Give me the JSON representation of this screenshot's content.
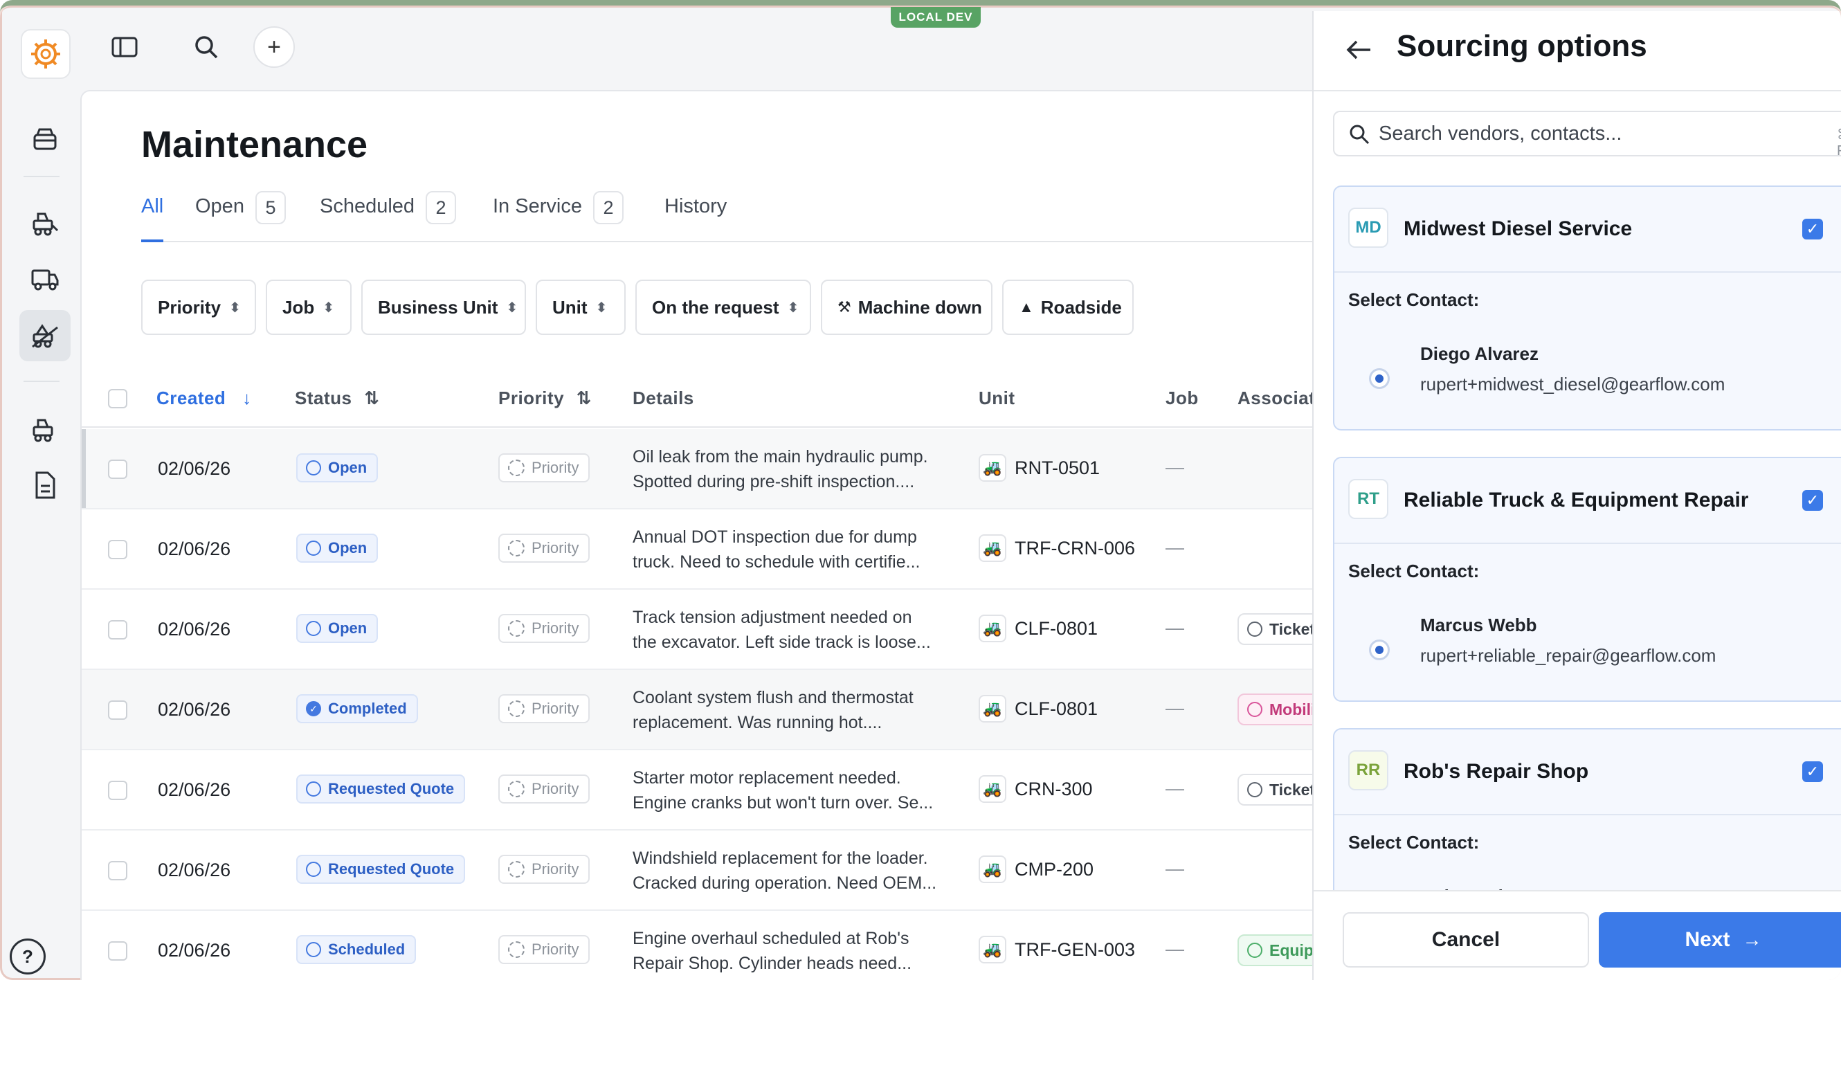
{
  "environment_badge": "LOCAL DEV",
  "page": {
    "title": "Maintenance",
    "tabs": [
      {
        "label": "All",
        "count": ""
      },
      {
        "label": "Open",
        "count": "5"
      },
      {
        "label": "Scheduled",
        "count": "2"
      },
      {
        "label": "In Service",
        "count": "2"
      },
      {
        "label": "History",
        "count": ""
      }
    ],
    "filters": [
      "Priority",
      "Job",
      "Business Unit",
      "Unit",
      "On the request",
      "Machine down",
      "Roadside"
    ],
    "columns": [
      "Created",
      "Status",
      "Priority",
      "Details",
      "Unit",
      "Job",
      "Associat"
    ],
    "rows": [
      {
        "date": "02/06/26",
        "status": "Open",
        "priority": "Priority",
        "details1": "Oil leak from the main hydraulic pump.",
        "details2": "Spotted during pre-shift inspection....",
        "unit": "RNT-0501",
        "job": "—",
        "assoc": ""
      },
      {
        "date": "02/06/26",
        "status": "Open",
        "priority": "Priority",
        "details1": "Annual DOT inspection due for dump",
        "details2": "truck. Need to schedule with certifie...",
        "unit": "TRF-CRN-006",
        "job": "—",
        "assoc": ""
      },
      {
        "date": "02/06/26",
        "status": "Open",
        "priority": "Priority",
        "details1": "Track tension adjustment needed on",
        "details2": "the excavator. Left side track is loose...",
        "unit": "CLF-0801",
        "job": "—",
        "assoc": "Ticket"
      },
      {
        "date": "02/06/26",
        "status": "Completed",
        "priority": "Priority",
        "details1": "Coolant system flush and thermostat",
        "details2": "replacement. Was running hot....",
        "unit": "CLF-0801",
        "job": "—",
        "assoc": "Mobili"
      },
      {
        "date": "02/06/26",
        "status": "Requested Quote",
        "priority": "Priority",
        "details1": "Starter motor replacement needed.",
        "details2": "Engine cranks but won't turn over. Se...",
        "unit": "CRN-300",
        "job": "—",
        "assoc": "Ticket"
      },
      {
        "date": "02/06/26",
        "status": "Requested Quote",
        "priority": "Priority",
        "details1": "Windshield replacement for the loader.",
        "details2": "Cracked during operation. Need OEM...",
        "unit": "CMP-200",
        "job": "—",
        "assoc": ""
      },
      {
        "date": "02/06/26",
        "status": "Scheduled",
        "priority": "Priority",
        "details1": "Engine overhaul scheduled at Rob's",
        "details2": "Repair Shop. Cylinder heads need...",
        "unit": "TRF-GEN-003",
        "job": "—",
        "assoc": "Equip"
      }
    ]
  },
  "panel": {
    "title": "Sourcing options",
    "search_placeholder": "Search vendors, contacts...",
    "search_shortcut": "⌘ F",
    "select_contact_label": "Select Contact:",
    "vendors": [
      {
        "initials": "MD",
        "name": "Midwest Diesel Service",
        "contact_name": "Diego Alvarez",
        "contact_email": "rupert+midwest_diesel@gearflow.com",
        "color": "#2a9bb3"
      },
      {
        "initials": "RT",
        "name": "Reliable Truck & Equipment Repair",
        "contact_name": "Marcus Webb",
        "contact_email": "rupert+reliable_repair@gearflow.com",
        "color": "#2f9f8a"
      },
      {
        "initials": "RR",
        "name": "Rob's Repair Shop",
        "contact_name": "Rob Martinez",
        "contact_email": "",
        "color": "#7ba33b"
      }
    ],
    "cancel_label": "Cancel",
    "next_label": "Next"
  },
  "colors": {
    "accent": "#3b7ae8",
    "env_badge": "#58a364",
    "logo": "#f08a24"
  }
}
